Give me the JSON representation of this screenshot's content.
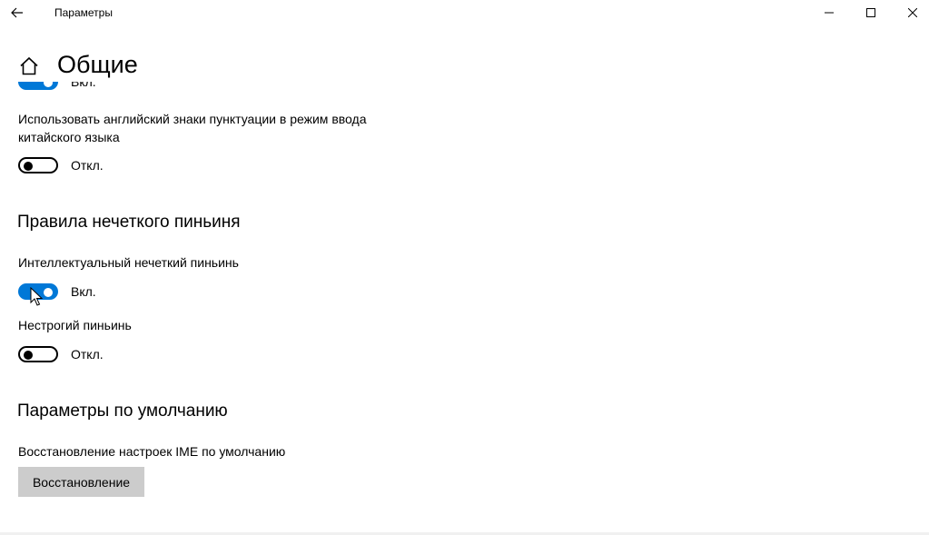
{
  "window": {
    "title": "Параметры",
    "controls": {
      "minimize_icon": "minimize-icon",
      "maximize_icon": "maximize-icon",
      "close_icon": "close-icon"
    }
  },
  "header": {
    "title": "Общие",
    "home_icon": "home-icon",
    "back_icon": "arrow-left-icon"
  },
  "settings": {
    "top_toggle": {
      "state": "Вкл.",
      "on": true
    },
    "english_punctuation": {
      "label": "Использовать английский знаки пунктуации в режим ввода китайского языка",
      "state": "Откл.",
      "on": false
    }
  },
  "fuzzy_pinyin": {
    "heading": "Правила нечеткого пиньиня",
    "smart_fuzzy": {
      "label": "Интеллектуальный нечеткий пиньинь",
      "state": "Вкл.",
      "on": true
    },
    "non_strict": {
      "label": "Нестрогий пиньинь",
      "state": "Откл.",
      "on": false
    }
  },
  "defaults": {
    "heading": "Параметры по умолчанию",
    "reset_label": "Восстановление настроек IME по умолчанию",
    "reset_button": "Восстановление"
  },
  "colors": {
    "accent": "#0078d7",
    "button_bg": "#cccccc",
    "text": "#000000",
    "background": "#ffffff"
  }
}
